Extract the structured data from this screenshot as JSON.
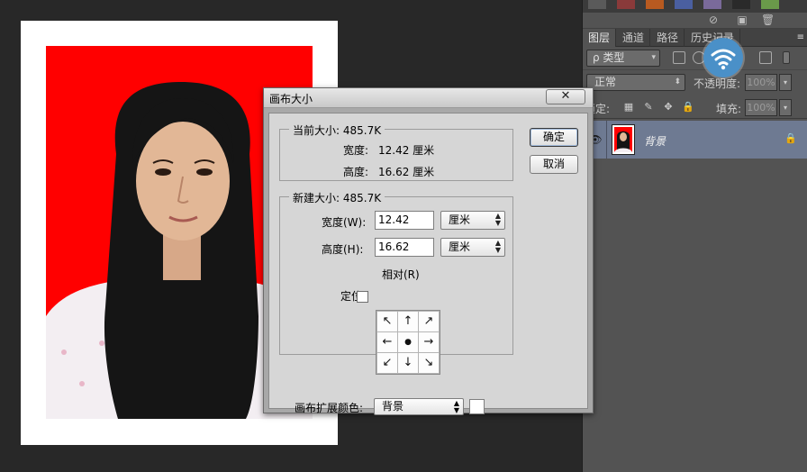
{
  "panel": {
    "tabs": [
      "图层",
      "通道",
      "路径",
      "历史记录"
    ],
    "menu_icon": "≡",
    "filter_label": "ρ 类型",
    "blend_mode": "正常",
    "opacity_label": "不透明度:",
    "opacity_value": "100%",
    "lock_label": "锁定:",
    "fill_label": "填充:",
    "fill_value": "100%",
    "layer_name": "背景"
  },
  "dialog": {
    "title": "画布大小",
    "close_glyph": "✕",
    "current": {
      "group_title": "当前大小: 485.7K",
      "width_label": "宽度:",
      "width_value": "12.42 厘米",
      "height_label": "高度:",
      "height_value": "16.62 厘米"
    },
    "new": {
      "group_title": "新建大小: 485.7K",
      "width_label": "宽度(W):",
      "width_value": "12.42",
      "width_unit": "厘米",
      "height_label": "高度(H):",
      "height_value": "16.62",
      "height_unit": "厘米",
      "relative_label": "相对(R)",
      "relative_checked": false,
      "anchor_label": "定位:",
      "anchor_arrows": [
        "↖",
        "↑",
        "↗",
        "←",
        "●",
        "→",
        "↙",
        "↓",
        "↘"
      ]
    },
    "ok_label": "确定",
    "cancel_label": "取消",
    "extension_label": "画布扩展颜色:",
    "extension_value": "背景",
    "extension_color": "#ffffff"
  },
  "colors": {
    "background_red": "#ff0000",
    "selected_layer": "#6e7a92"
  }
}
